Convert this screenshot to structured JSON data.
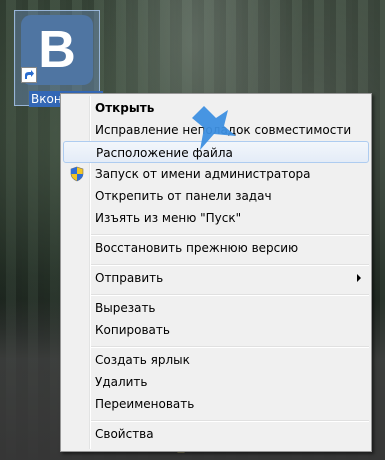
{
  "desktop": {
    "icon": {
      "label": "Вконтакте",
      "logo_letter": "B",
      "logo_color": "#4f75a2"
    }
  },
  "context_menu": {
    "items": [
      {
        "label": "Открыть",
        "bold": true
      },
      {
        "label": "Исправление неполадок совместимости"
      },
      {
        "label": "Расположение файла",
        "highlighted": true
      },
      {
        "label": "Запуск от имени администратора",
        "icon": "uac-shield-icon"
      },
      {
        "label": "Открепить от панели задач"
      },
      {
        "label": "Изъять из меню \"Пуск\""
      },
      {
        "label": "Восстановить прежнюю версию"
      },
      {
        "label": "Отправить",
        "submenu": true
      },
      {
        "label": "Вырезать"
      },
      {
        "label": "Копировать"
      },
      {
        "label": "Создать ярлык"
      },
      {
        "label": "Удалить"
      },
      {
        "label": "Переименовать"
      },
      {
        "label": "Свойства"
      }
    ]
  },
  "colors": {
    "highlight_border": "#aeccf0",
    "pointer_arrow": "#3d8fe0"
  }
}
